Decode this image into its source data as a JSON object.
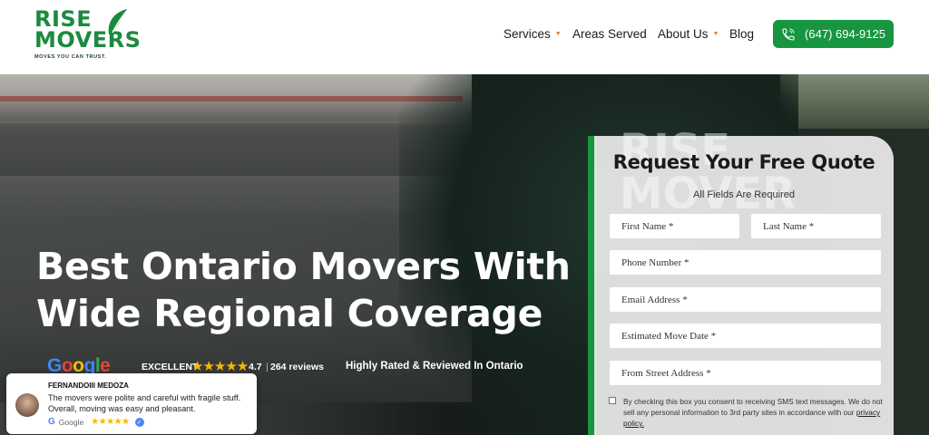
{
  "logo": {
    "line1": "RISE",
    "line2": "MOVERS",
    "tagline": "MOVES YOU CAN TRUST."
  },
  "nav": {
    "items": [
      {
        "label": "Services",
        "has_dropdown": true
      },
      {
        "label": "Areas Served",
        "has_dropdown": false
      },
      {
        "label": "About Us",
        "has_dropdown": true
      },
      {
        "label": "Blog",
        "has_dropdown": false
      }
    ],
    "phone": "(647) 694-9125"
  },
  "hero": {
    "title_line1": "Best Ontario Movers With",
    "title_line2": "Wide Regional Coverage"
  },
  "rating": {
    "google": "Google",
    "excellent": "EXCELLENT",
    "stars": "★★★★★",
    "score": "4.7",
    "separator": "|",
    "reviews": "264 reviews",
    "tagline": "Highly Rated & Reviewed In Ontario"
  },
  "review": {
    "name": "FERNANDOIII MEDOZA",
    "text": "The movers were polite and careful with fragile stuff. Overall, moving was easy and pleasant.",
    "source": "Google",
    "stars": "★★★★★"
  },
  "form": {
    "watermark_line1": "RISE",
    "watermark_line2": "MOVER",
    "title": "Request Your Free Quote",
    "subtitle": "All Fields Are Required",
    "first_name": "First Name *",
    "last_name": "Last Name *",
    "phone": "Phone Number *",
    "email": "Email Address *",
    "move_date": "Estimated Move Date *",
    "from_address": "From Street Address *",
    "consent_text": "By checking this box you consent to receiving SMS text messages. We do not sell any personal information to 3rd party sites in accordance with our",
    "consent_link": "privacy policy."
  },
  "colors": {
    "brand_green": "#17963f",
    "star": "#f6b800",
    "caret": "#d9822b"
  }
}
